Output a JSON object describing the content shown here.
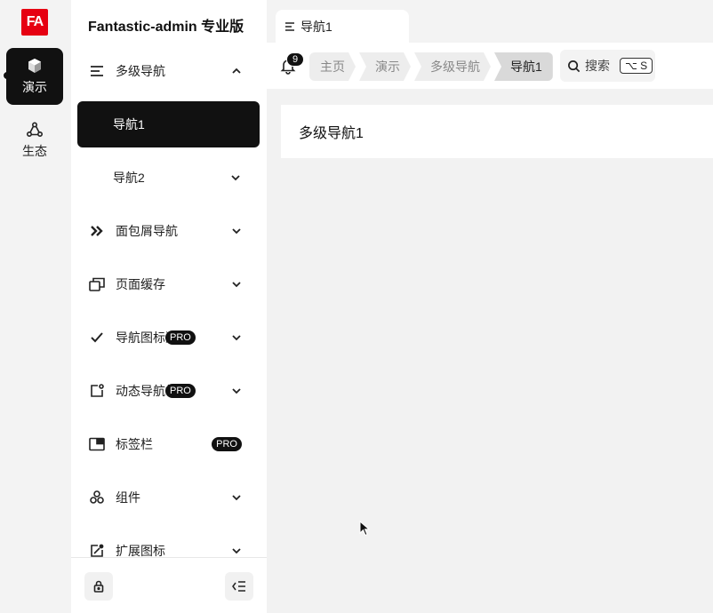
{
  "app": {
    "logo_text": "FA",
    "brand_color": "#e60012",
    "title": "Fantastic-admin 专业版"
  },
  "rail": {
    "items": [
      {
        "label": "演示",
        "icon": "cube-icon"
      },
      {
        "label": "生态",
        "icon": "ecosystem-icon"
      }
    ]
  },
  "sidebar": {
    "items": [
      {
        "label": "多级导航",
        "icon": "menu-lines-icon"
      },
      {
        "label": "导航1"
      },
      {
        "label": "导航2"
      },
      {
        "label": "面包屑导航",
        "icon": "double-chevron-icon"
      },
      {
        "label": "页面缓存",
        "icon": "copy-window-icon"
      },
      {
        "label": "导航图标激活",
        "icon": "check-icon",
        "badge": "PRO"
      },
      {
        "label": "动态导航标记",
        "icon": "badge-square-icon",
        "badge": "PRO"
      },
      {
        "label": "标签栏",
        "icon": "tab-window-icon",
        "badge": "PRO"
      },
      {
        "label": "组件",
        "icon": "components-icon"
      },
      {
        "label": "扩展图标",
        "icon": "extend-icon"
      }
    ]
  },
  "tabs": [
    {
      "label": "导航1"
    }
  ],
  "toolbar": {
    "notification_count": "9",
    "breadcrumbs": [
      "主页",
      "演示",
      "多级导航",
      "导航1"
    ],
    "search_label": "搜索",
    "search_shortcut": "⌥ S"
  },
  "main": {
    "page_title": "多级导航1"
  }
}
